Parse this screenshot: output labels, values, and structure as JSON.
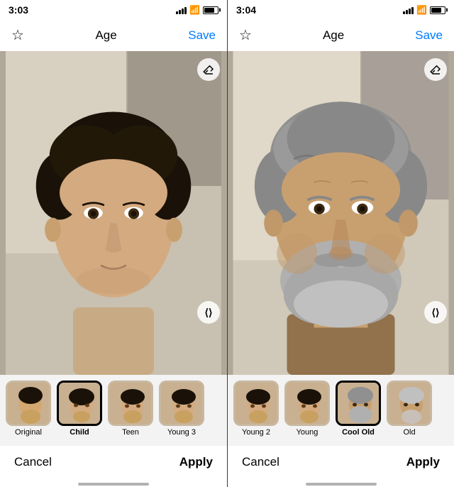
{
  "panels": [
    {
      "id": "left",
      "status": {
        "time": "3:03",
        "signal": [
          4,
          6,
          8,
          10,
          12
        ],
        "wifi": true,
        "battery": 75
      },
      "topBar": {
        "starLabel": "☆",
        "title": "Age",
        "saveLabel": "Save"
      },
      "eraserIcon": "⌫",
      "compareIcon": "⟨⟩",
      "thumbs": [
        {
          "label": "Original",
          "bold": false,
          "selected": false
        },
        {
          "label": "Child",
          "bold": true,
          "selected": true
        },
        {
          "label": "Teen",
          "bold": false,
          "selected": false
        },
        {
          "label": "Young 3",
          "bold": false,
          "selected": false
        }
      ],
      "bottomBar": {
        "cancelLabel": "Cancel",
        "applyLabel": "Apply"
      }
    },
    {
      "id": "right",
      "status": {
        "time": "3:04",
        "signal": [
          4,
          6,
          8,
          10,
          12
        ],
        "wifi": true,
        "battery": 75
      },
      "topBar": {
        "starLabel": "☆",
        "title": "Age",
        "saveLabel": "Save"
      },
      "eraserIcon": "⌫",
      "compareIcon": "⟨⟩",
      "thumbs": [
        {
          "label": "Young 2",
          "bold": false,
          "selected": false
        },
        {
          "label": "Young",
          "bold": false,
          "selected": false
        },
        {
          "label": "Cool Old",
          "bold": true,
          "selected": true
        },
        {
          "label": "Old",
          "bold": false,
          "selected": false
        }
      ],
      "bottomBar": {
        "cancelLabel": "Cancel",
        "applyLabel": "Apply"
      }
    }
  ]
}
